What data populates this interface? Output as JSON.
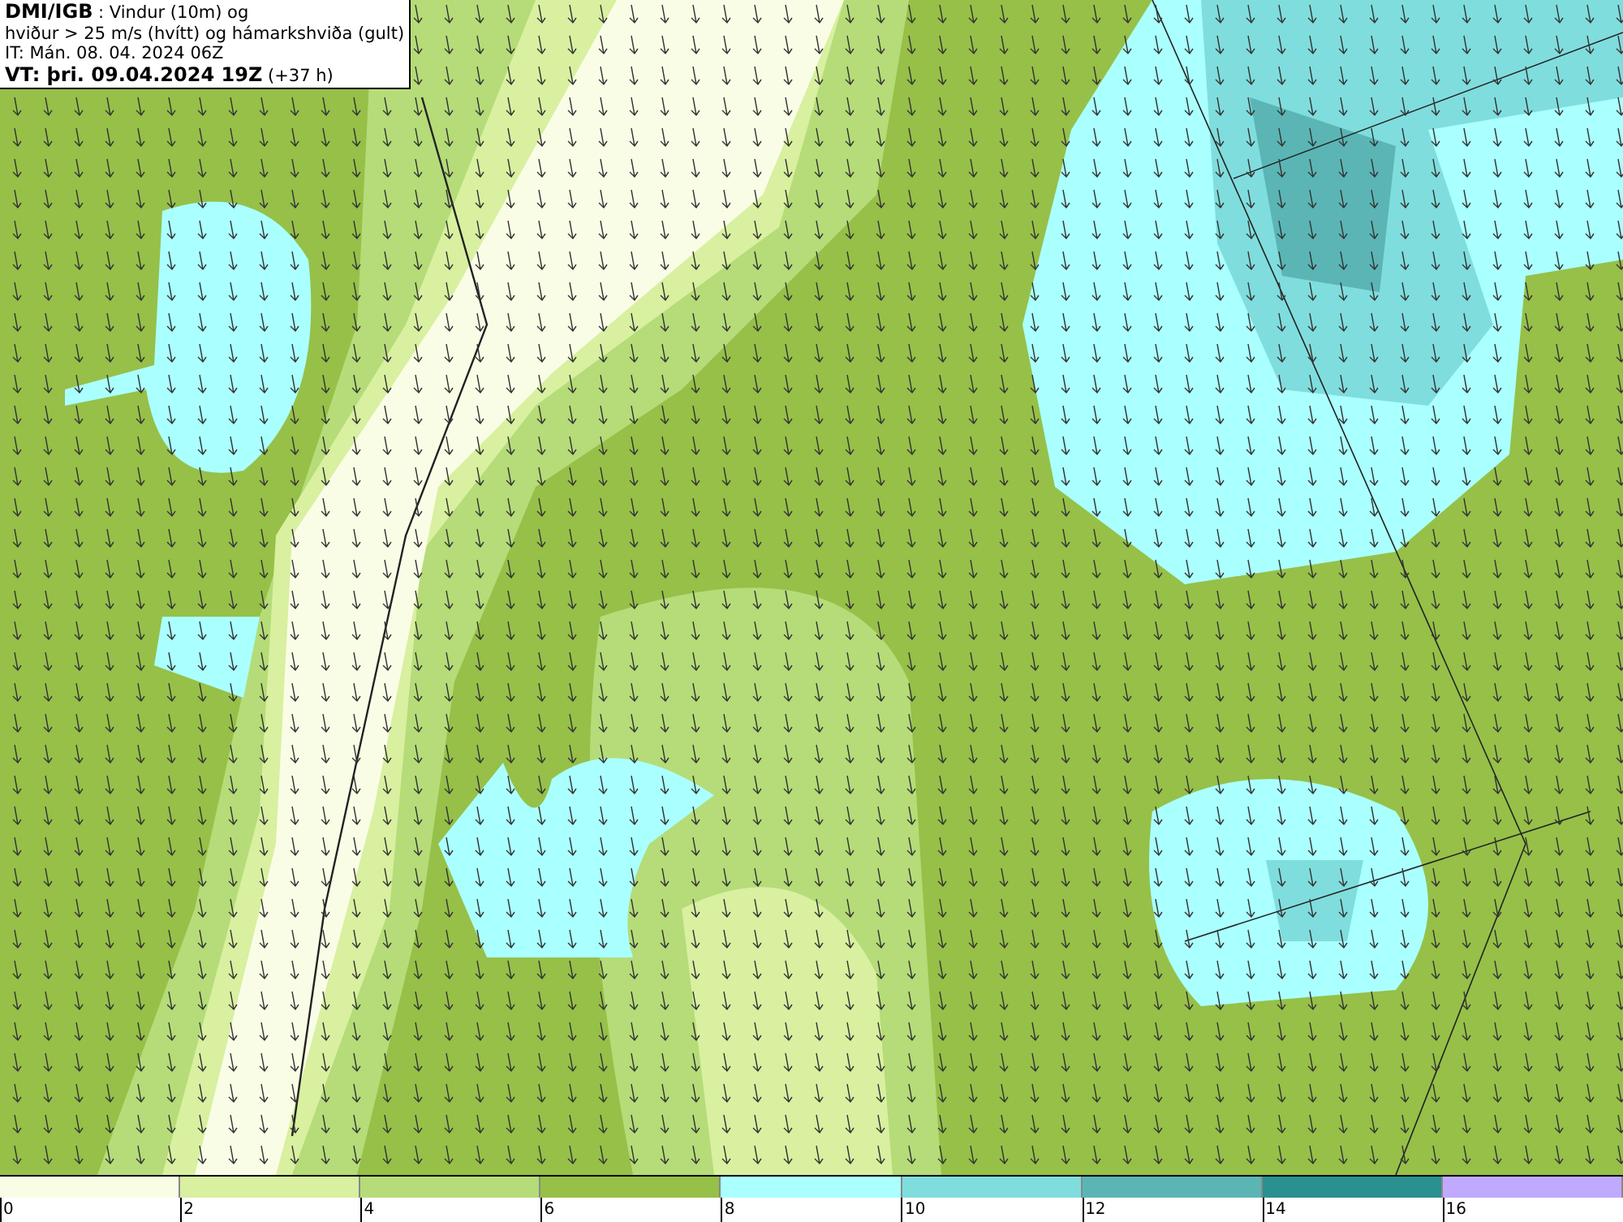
{
  "info_box": {
    "lines": [
      "**DMI/IGB** : Vindur (10m) og",
      "hviður > 25 m/s (hvítt) og hámarkshviða (gult)",
      "IT: Mán. 08. 04. 2024 06Z",
      "**VT: þri. 09.04.2024 19Z** (+37 h)"
    ]
  },
  "legend": {
    "bins": [
      {
        "color": "#fafde6"
      },
      {
        "color": "#d8f0a0"
      },
      {
        "color": "#b5dc78"
      },
      {
        "color": "#96c048"
      },
      {
        "color": "#aaffff"
      },
      {
        "color": "#80dddd"
      },
      {
        "color": "#5bb5b5"
      },
      {
        "color": "#2a9090"
      },
      {
        "color": "#c0aaff"
      }
    ],
    "ticks": [
      "0",
      "2",
      "4",
      "6",
      "8",
      "10",
      "12",
      "14",
      "16"
    ]
  }
}
